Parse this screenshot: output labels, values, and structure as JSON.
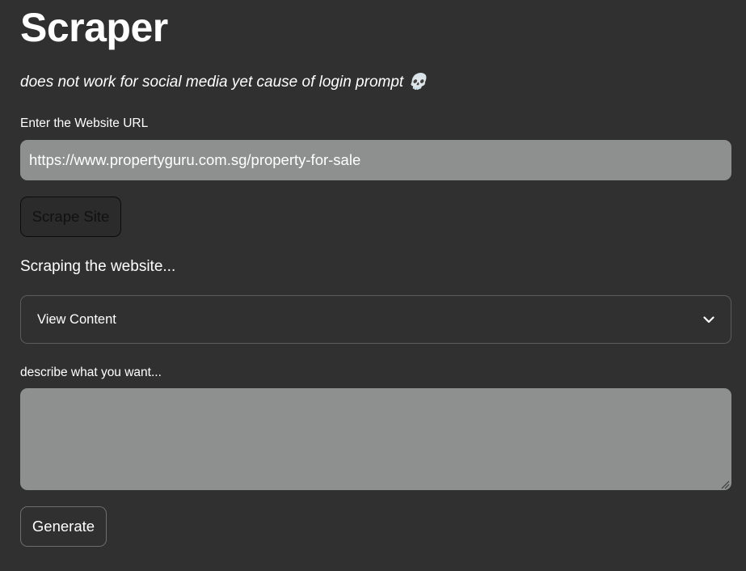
{
  "page": {
    "title": "Scraper",
    "subtitle": "does not work for social media yet cause of login prompt 💀"
  },
  "url_field": {
    "label": "Enter the Website URL",
    "value": "https://www.propertyguru.com.sg/property-for-sale"
  },
  "scrape_button": {
    "label": "Scrape Site"
  },
  "status": {
    "text": "Scraping the website..."
  },
  "content_expander": {
    "label": "View Content",
    "icon": "chevron-down-icon"
  },
  "description_field": {
    "label": "describe what you want...",
    "value": ""
  },
  "generate_button": {
    "label": "Generate"
  },
  "colors": {
    "background": "#303030",
    "input_background": "#8e908f",
    "text": "#ffffff"
  }
}
